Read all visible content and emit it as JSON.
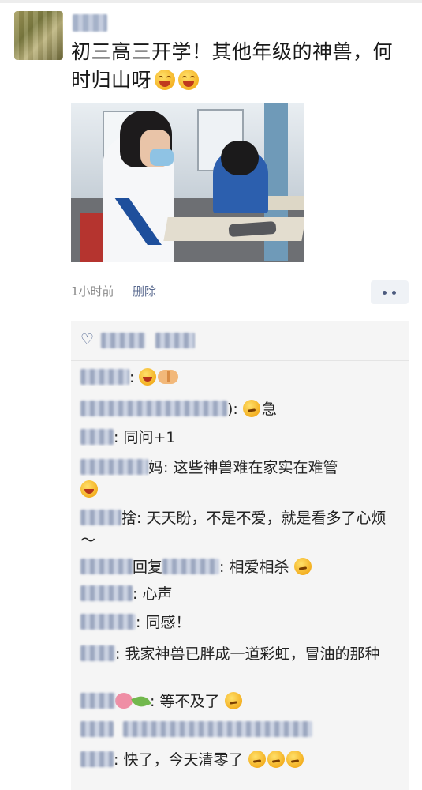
{
  "post": {
    "text": "初三高三开学！其他年级的神兽，何时归山呀",
    "time": "1小时前",
    "delete_label": "删除"
  },
  "icons": {
    "like": "heart-icon",
    "more": "more-dots-icon",
    "post_emoji": "grinning-sweat-emoji",
    "comment_emoji_think": "thinking-emoji",
    "comment_emoji_laugh": "laughing-tears-emoji",
    "comment_emoji_hand": "handshake-emoji"
  },
  "colors": {
    "name_link": "#576b95",
    "comment_bg": "#f5f5f5",
    "meta": "#8a8a8a"
  },
  "comments": [
    {
      "text": ":"
    },
    {
      "text": "):"
    },
    {
      "text": "急"
    },
    {
      "text": ": 同问+1"
    },
    {
      "text": "妈: 这些神兽难在家实在难管"
    },
    {
      "text": "捨: 天天盼，不是不爱，就是看多了心烦～"
    },
    {
      "reply_text": "回复",
      "text": ": 相爱相杀"
    },
    {
      "text": ": 心声"
    },
    {
      "text": ": 同感！"
    },
    {
      "text": ": 我家神兽已胖成一道彩虹，冒油的那种"
    },
    {
      "text": ": 等不及了"
    },
    {
      "text": ": 快了，今天清零了"
    }
  ]
}
